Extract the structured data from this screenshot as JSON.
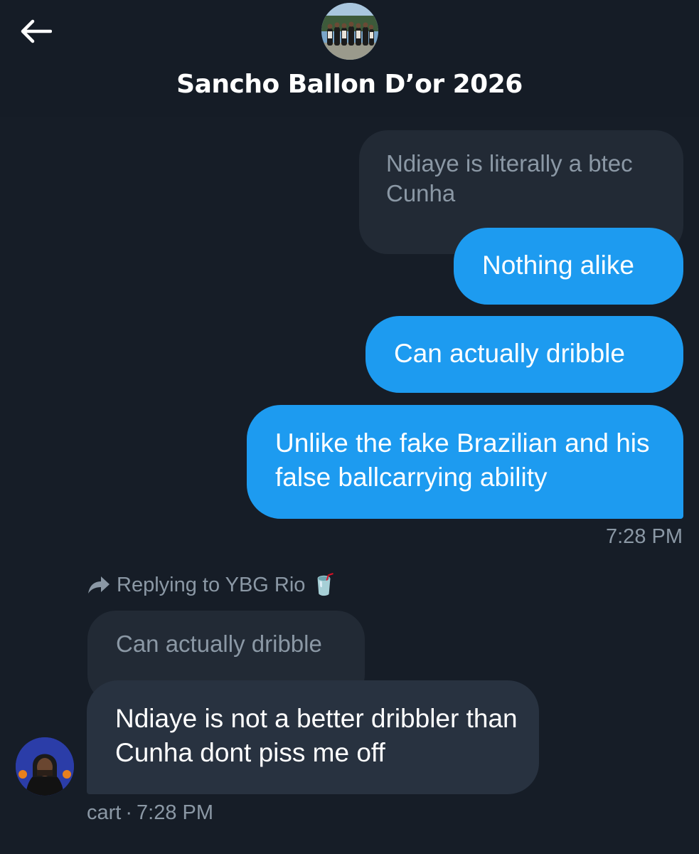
{
  "header": {
    "title": "Sancho Ballon D’or 2026",
    "back_icon": "arrow-left-icon",
    "avatar": "group-photo-avatar"
  },
  "messages": {
    "quoted_top": "Ndiaye is literally a btec Cunha",
    "sent": [
      {
        "text": "Nothing alike"
      },
      {
        "text": "Can actually dribble"
      },
      {
        "text": "Unlike the fake Brazilian and his false ballcarrying ability"
      }
    ],
    "sent_time": "7:28 PM",
    "reply_context": {
      "prefix": "Replying to YBG Rio",
      "emoji": "🥤",
      "icon": "reply-arrow-icon"
    },
    "quoted_reply": "Can actually dribble",
    "received": {
      "text": "Ndiaye is not a better dribbler than Cunha dont piss me off",
      "sender": "cart",
      "time": "7:28 PM"
    }
  },
  "colors": {
    "background": "#161d27",
    "sent_bubble": "#1d9bf0",
    "received_bubble": "#283240",
    "quoted_bubble": "#222a35",
    "muted_text": "#8b98a5"
  }
}
